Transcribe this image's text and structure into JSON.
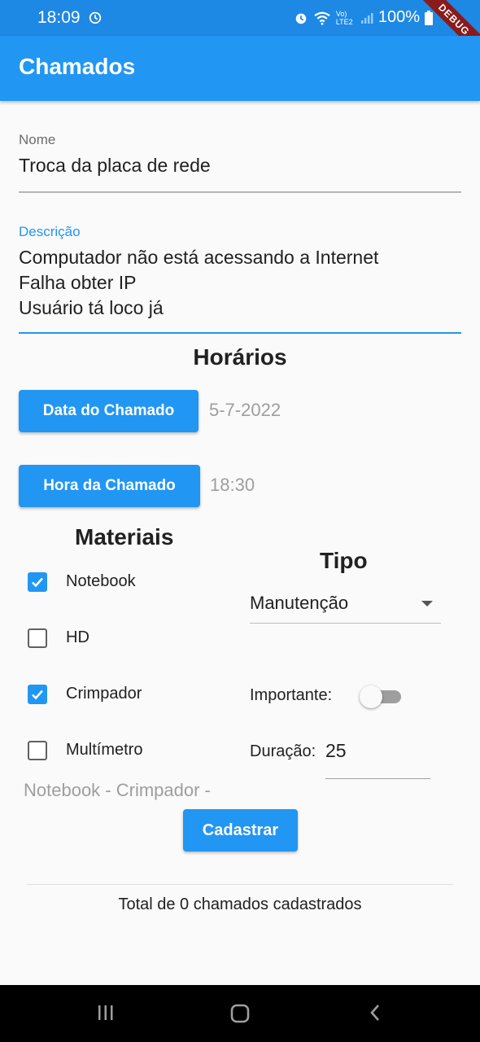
{
  "status_bar": {
    "time": "18:09",
    "network": "Vo) LTE2",
    "battery": "100%",
    "debug_label": "DEBUG"
  },
  "app_bar": {
    "title": "Chamados"
  },
  "form": {
    "nome": {
      "label": "Nome",
      "value": "Troca da placa de rede"
    },
    "descricao": {
      "label": "Descrição",
      "lines": [
        "Computador não está acessando a Internet",
        "Falha obter IP",
        "Usuário tá loco já"
      ]
    }
  },
  "horarios": {
    "title": "Horários",
    "date_button": "Data do Chamado",
    "date_value": "5-7-2022",
    "time_button": "Hora da Chamado",
    "time_value": "18:30"
  },
  "materiais": {
    "title": "Materiais",
    "items": [
      {
        "label": "Notebook",
        "checked": true
      },
      {
        "label": "HD",
        "checked": false
      },
      {
        "label": "Crimpador",
        "checked": true
      },
      {
        "label": "Multímetro",
        "checked": false
      }
    ],
    "selected_summary": "Notebook - Crimpador -"
  },
  "tipo": {
    "title": "Tipo",
    "selected": "Manutenção",
    "importante_label": "Importante:",
    "importante_on": false,
    "duracao_label": "Duração:",
    "duracao_value": "25"
  },
  "actions": {
    "submit_label": "Cadastrar"
  },
  "footer": {
    "total_text": "Total de 0 chamados cadastrados"
  },
  "colors": {
    "primary": "#2196f3",
    "status_bar": "#1e88e5"
  }
}
